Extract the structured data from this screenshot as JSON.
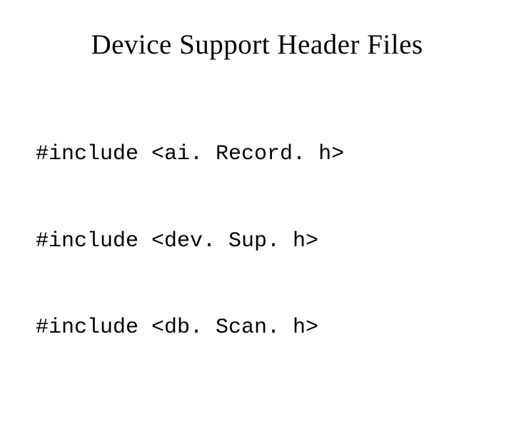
{
  "slide": {
    "title": "Device Support Header Files",
    "code": {
      "line1": "#include <ai. Record. h>",
      "line2": "#include <dev. Sup. h>",
      "line3": "#include <db. Scan. h>"
    }
  }
}
